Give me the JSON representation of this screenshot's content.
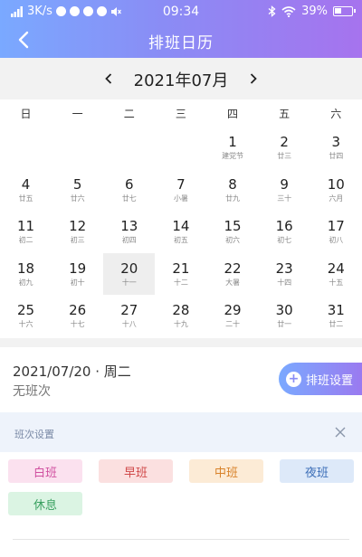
{
  "status_bar": {
    "speed": "3K/s",
    "time": "09:34",
    "battery": "39%",
    "battery_level": 0.39
  },
  "nav": {
    "title": "排班日历"
  },
  "calendar": {
    "month_label": "2021年07月",
    "weekdays": [
      "日",
      "一",
      "二",
      "三",
      "四",
      "五",
      "六"
    ],
    "selected_day": "20",
    "days": [
      {
        "day": "",
        "lunar": ""
      },
      {
        "day": "",
        "lunar": ""
      },
      {
        "day": "",
        "lunar": ""
      },
      {
        "day": "",
        "lunar": ""
      },
      {
        "day": "1",
        "lunar": "建党节"
      },
      {
        "day": "2",
        "lunar": "廿三"
      },
      {
        "day": "3",
        "lunar": "廿四"
      },
      {
        "day": "4",
        "lunar": "廿五"
      },
      {
        "day": "5",
        "lunar": "廿六"
      },
      {
        "day": "6",
        "lunar": "廿七"
      },
      {
        "day": "7",
        "lunar": "小暑"
      },
      {
        "day": "8",
        "lunar": "廿九"
      },
      {
        "day": "9",
        "lunar": "三十"
      },
      {
        "day": "10",
        "lunar": "六月"
      },
      {
        "day": "11",
        "lunar": "初二"
      },
      {
        "day": "12",
        "lunar": "初三"
      },
      {
        "day": "13",
        "lunar": "初四"
      },
      {
        "day": "14",
        "lunar": "初五"
      },
      {
        "day": "15",
        "lunar": "初六"
      },
      {
        "day": "16",
        "lunar": "初七"
      },
      {
        "day": "17",
        "lunar": "初八"
      },
      {
        "day": "18",
        "lunar": "初九"
      },
      {
        "day": "19",
        "lunar": "初十"
      },
      {
        "day": "20",
        "lunar": "十一"
      },
      {
        "day": "21",
        "lunar": "十二"
      },
      {
        "day": "22",
        "lunar": "大暑"
      },
      {
        "day": "23",
        "lunar": "十四"
      },
      {
        "day": "24",
        "lunar": "十五"
      },
      {
        "day": "25",
        "lunar": "十六"
      },
      {
        "day": "26",
        "lunar": "十七"
      },
      {
        "day": "27",
        "lunar": "十八"
      },
      {
        "day": "28",
        "lunar": "十九"
      },
      {
        "day": "29",
        "lunar": "二十"
      },
      {
        "day": "30",
        "lunar": "廿一"
      },
      {
        "day": "31",
        "lunar": "廿二"
      }
    ]
  },
  "info": {
    "date": "2021/07/20 · 周二",
    "status": "无班次",
    "schedule_button": "排班设置"
  },
  "shift_panel": {
    "title": "班次设置",
    "shifts": {
      "day": "白班",
      "morning": "早班",
      "middle": "中班",
      "night": "夜班",
      "rest": "休息"
    }
  },
  "colors": {
    "header_start": "#7aa9ff",
    "header_end": "#a673ee"
  }
}
